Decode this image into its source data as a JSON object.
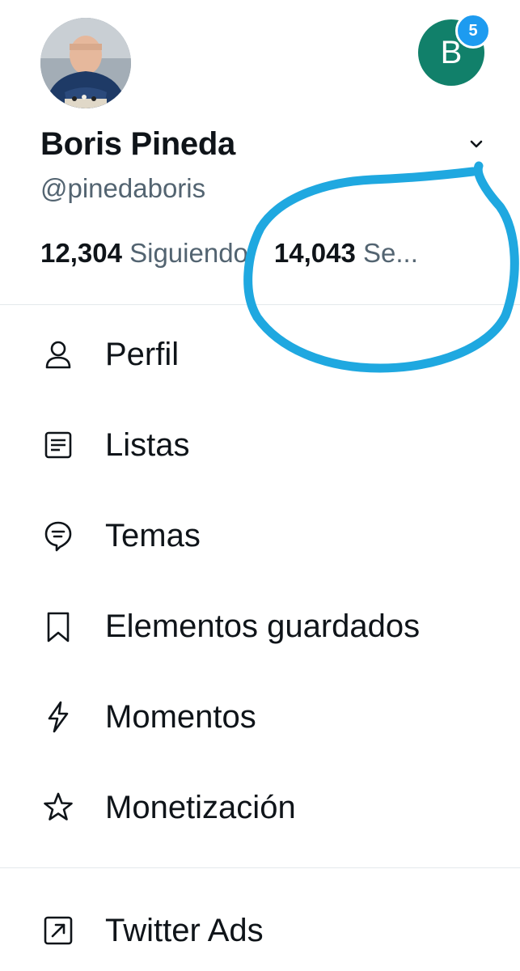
{
  "profile": {
    "display_name": "Boris Pineda",
    "handle": "@pinedaboris",
    "following_count": "12,304",
    "following_label": "Siguiendo",
    "followers_count": "14,043",
    "followers_label": "Se..."
  },
  "account_switcher": {
    "initial": "B",
    "notification_count": "5",
    "accent_color": "#11806a",
    "badge_color": "#1d9bf0"
  },
  "menu": {
    "items": [
      {
        "label": "Perfil",
        "icon": "person-icon"
      },
      {
        "label": "Listas",
        "icon": "list-icon"
      },
      {
        "label": "Temas",
        "icon": "topics-icon"
      },
      {
        "label": "Elementos guardados",
        "icon": "bookmark-icon"
      },
      {
        "label": "Momentos",
        "icon": "lightning-icon"
      },
      {
        "label": "Monetización",
        "icon": "star-icon"
      },
      {
        "label": "Twitter Ads",
        "icon": "external-arrow-icon"
      }
    ]
  },
  "annotation": {
    "color": "#1fa8e0"
  }
}
